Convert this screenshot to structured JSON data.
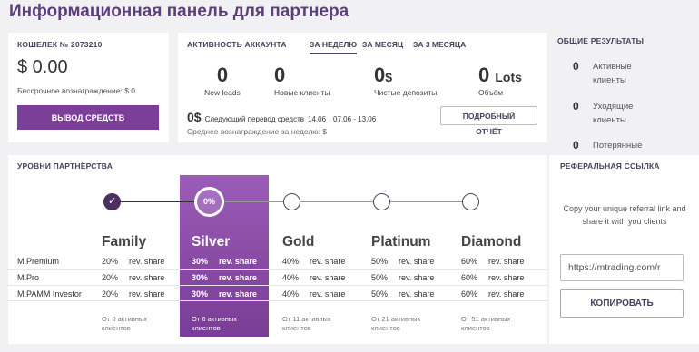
{
  "page_title": "Информационная панель для партнера",
  "wallet": {
    "label": "КОШЕЛЕК № 2073210",
    "amount": "$ 0.00",
    "perpetual": "Бессрочное вознаграждение: $ 0",
    "withdraw_button": "ВЫВОД СРЕДСТВ"
  },
  "activity": {
    "label": "АКТИВНОСТЬ АККАУНТА",
    "tabs": [
      "ЗА НЕДЕЛЮ",
      "ЗА МЕСЯЦ",
      "ЗА 3 МЕСЯЦА"
    ],
    "active_tab": "ЗА НЕДЕЛЮ",
    "stats": [
      {
        "value": "0",
        "unit": "",
        "label": "New leads"
      },
      {
        "value": "0",
        "unit": "",
        "label": "Новые клиенты"
      },
      {
        "value": "0",
        "unit": "$",
        "label": "Чистые депозиты"
      },
      {
        "value": "0",
        "unit": "Lots",
        "label": "Объём"
      }
    ],
    "next_amount": "0$",
    "next_label": "Следующий перевод средств",
    "next_date": "14.06",
    "next_period": "07.06 - 13.06",
    "avg_reward": "Среднее вознаграждение за неделю: $",
    "detail_button": "ПОДРОБНЫЙ",
    "detail_button_line2": "ОТЧЁТ"
  },
  "overall": {
    "label": "ОБЩИЕ РЕЗУЛЬТАТЫ",
    "rows": [
      {
        "count": "0",
        "label": "Активные клиенты"
      },
      {
        "count": "0",
        "label": "Уходящие клиенты"
      },
      {
        "count": "0",
        "label": "Потерянные"
      }
    ]
  },
  "levels": {
    "label": "УРОВНИ ПАРТНЁРСТВА",
    "current_progress": "0%",
    "names": [
      "Family",
      "Silver",
      "Gold",
      "Platinum",
      "Diamond"
    ],
    "current_index": 1,
    "accounts": [
      "M.Premium",
      "M.Pro",
      "M.PAMM Investor"
    ],
    "share_label": "rev. share",
    "percents": [
      "20%",
      "30%",
      "40%",
      "50%",
      "60%"
    ],
    "footnotes": [
      "От 0 активных клиентов",
      "От 6 активных клиентов",
      "От 11 активных клиентов",
      "От 21 активных клиентов",
      "От 51 активных клиентов"
    ]
  },
  "referral": {
    "label": "РЕФЕРАЛЬНАЯ ССЫЛКА",
    "description": "Copy your unique referral link and share it with you clients",
    "link": "https://mtrading.com/r",
    "copy_button": "КОПИРОВАТЬ"
  }
}
